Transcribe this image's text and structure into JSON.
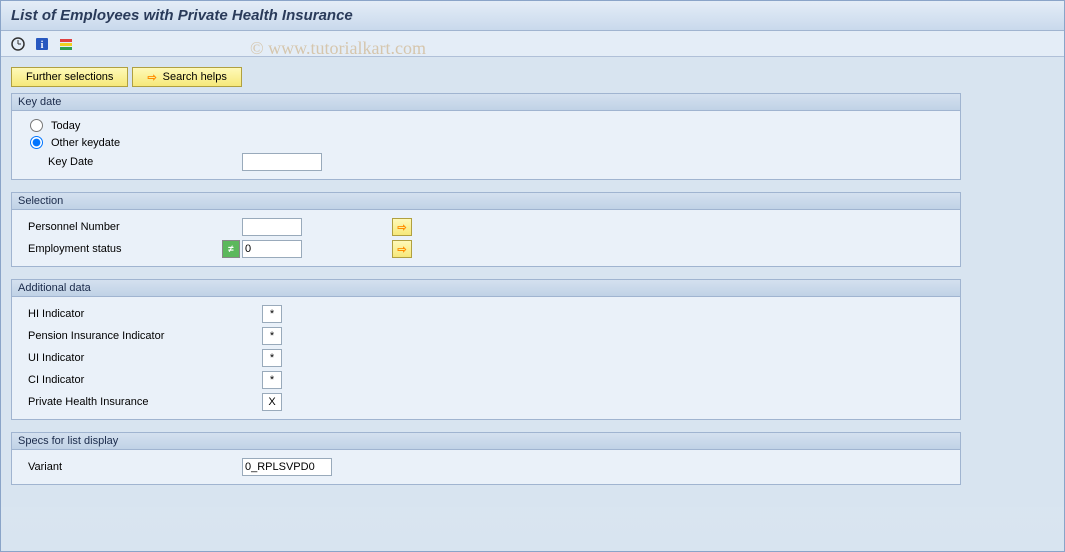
{
  "title": "List of Employees with Private Health Insurance",
  "watermark": "© www.tutorialkart.com",
  "buttons": {
    "further_selections": "Further selections",
    "search_helps": "Search helps"
  },
  "groups": {
    "keydate": {
      "title": "Key date",
      "today": "Today",
      "other": "Other keydate",
      "keydate_label": "Key Date",
      "keydate_value": ""
    },
    "selection": {
      "title": "Selection",
      "pernr_label": "Personnel Number",
      "pernr_value": "",
      "empstatus_label": "Employment status",
      "empstatus_value": "0"
    },
    "additional": {
      "title": "Additional data",
      "hi_label": "HI Indicator",
      "hi_value": "*",
      "pension_label": "Pension Insurance Indicator",
      "pension_value": "*",
      "ui_label": "UI Indicator",
      "ui_value": "*",
      "ci_label": "CI Indicator",
      "ci_value": "*",
      "phi_label": "Private Health Insurance",
      "phi_value": "X"
    },
    "specs": {
      "title": "Specs for list display",
      "variant_label": "Variant",
      "variant_value": "0_RPLSVPD0"
    }
  }
}
